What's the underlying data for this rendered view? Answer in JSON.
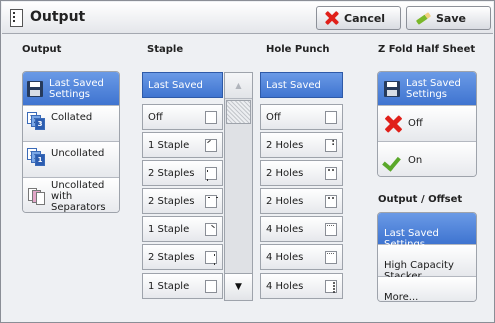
{
  "header": {
    "title": "Output",
    "cancel_label": "Cancel",
    "save_label": "Save"
  },
  "output": {
    "title": "Output",
    "items": [
      {
        "label": "Last Saved\nSettings",
        "icon": "disk-icon",
        "selected": true
      },
      {
        "label": "Collated",
        "icon": "collated-icon",
        "selected": false
      },
      {
        "label": "Uncollated",
        "icon": "uncollated-icon",
        "selected": false
      },
      {
        "label": "Uncollated with\nSeparators",
        "icon": "separators-icon",
        "selected": false
      }
    ]
  },
  "staple": {
    "title": "Staple",
    "items": [
      {
        "label": "Last Saved",
        "selected": true
      },
      {
        "label": "Off"
      },
      {
        "label": "1 Staple"
      },
      {
        "label": "2 Staples"
      },
      {
        "label": "2 Staples"
      },
      {
        "label": "1 Staple"
      },
      {
        "label": "2 Staples"
      },
      {
        "label": "1 Staple"
      }
    ]
  },
  "hole_punch": {
    "title": "Hole Punch",
    "items": [
      {
        "label": "Last Saved",
        "selected": true
      },
      {
        "label": "Off"
      },
      {
        "label": "2 Holes"
      },
      {
        "label": "2 Holes"
      },
      {
        "label": "2 Holes"
      },
      {
        "label": "4 Holes"
      },
      {
        "label": "4 Holes"
      },
      {
        "label": "4 Holes"
      }
    ]
  },
  "z_fold": {
    "title": "Z Fold Half Sheet",
    "items": [
      {
        "label": "Last Saved\nSettings",
        "selected": true
      },
      {
        "label": "Off"
      },
      {
        "label": "On"
      }
    ]
  },
  "output_offset": {
    "title": "Output / Offset",
    "items": [
      {
        "label": "Last Saved\nSettings",
        "selected": true
      },
      {
        "label": "High Capacity Stacker\n- Top Tray"
      },
      {
        "label": "More..."
      }
    ]
  },
  "colors": {
    "selected": "#4f84dc",
    "cancel_red": "#e0201a",
    "check_green": "#5aa82a"
  }
}
